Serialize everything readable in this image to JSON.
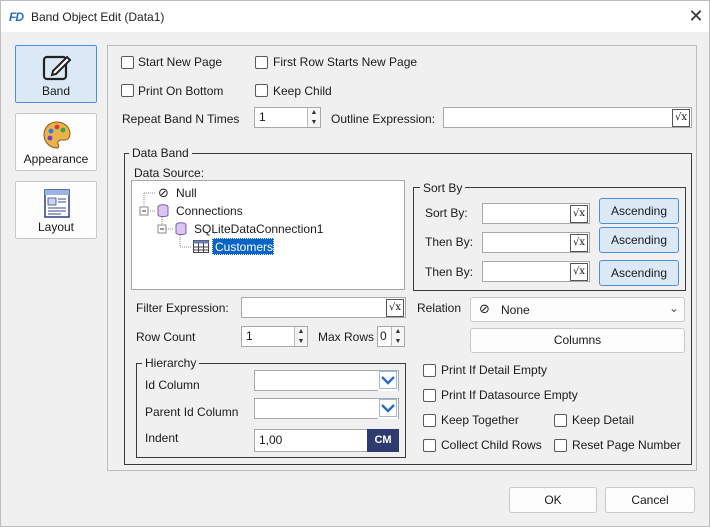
{
  "window": {
    "title": "Band Object Edit (Data1)",
    "logo": "FD"
  },
  "sidebar": [
    {
      "label": "Band",
      "icon": "pencil-edit-icon",
      "active": true
    },
    {
      "label": "Appearance",
      "icon": "palette-icon",
      "active": false
    },
    {
      "label": "Layout",
      "icon": "layout-icon",
      "active": false
    }
  ],
  "band": {
    "start_new_page": "Start New Page",
    "first_row_new_page": "First Row Starts New Page",
    "print_on_bottom": "Print On Bottom",
    "keep_child": "Keep Child",
    "repeat_label": "Repeat Band N Times",
    "repeat_value": "1",
    "outline_label": "Outline Expression:",
    "outline_value": ""
  },
  "data_band": {
    "group_title": "Data Band",
    "data_source_label": "Data Source:",
    "tree": {
      "null": "Null",
      "connections": "Connections",
      "connection": "SQLiteDataConnection1",
      "table": "Customers"
    },
    "sort": {
      "title": "Sort By",
      "rows": [
        {
          "label": "Sort By:",
          "order": "Ascending"
        },
        {
          "label": "Then By:",
          "order": "Ascending"
        },
        {
          "label": "Then By:",
          "order": "Ascending"
        }
      ]
    },
    "filter_label": "Filter Expression:",
    "relation_label": "Relation",
    "relation_value": "None",
    "row_count_label": "Row Count",
    "row_count_value": "1",
    "max_rows_label": "Max Rows",
    "max_rows_value": "0",
    "columns_button": "Columns",
    "hierarchy": {
      "title": "Hierarchy",
      "id_column": "Id Column",
      "parent_id_column": "Parent Id Column",
      "indent": "Indent",
      "indent_value": "1,00",
      "unit": "CM"
    },
    "options": {
      "print_if_detail_empty": "Print If Detail Empty",
      "print_if_datasource_empty": "Print If Datasource Empty",
      "keep_together": "Keep Together",
      "keep_detail": "Keep Detail",
      "collect_child_rows": "Collect Child Rows",
      "reset_page_number": "Reset Page Number"
    }
  },
  "footer": {
    "ok": "OK",
    "cancel": "Cancel"
  },
  "colors": {
    "accent": "#4a90d9",
    "selection": "#0a64c8",
    "unit_button": "#2f3b6e"
  }
}
